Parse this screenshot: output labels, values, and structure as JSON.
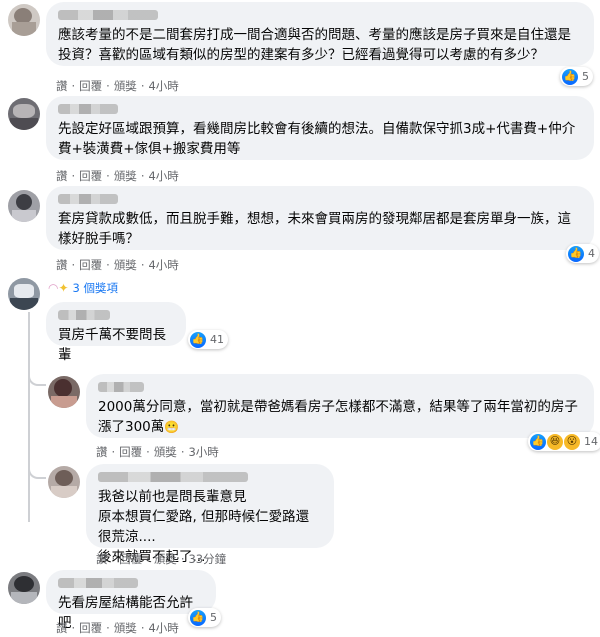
{
  "actions": {
    "like": "讚",
    "reply": "回覆",
    "share": "頒獎",
    "dot": "·"
  },
  "comments": [
    {
      "text": "應該考量的不是二間套房打成一間合適與否的問題、考量的應該是房子買來是自住還是投資？喜歡的區域有類似的房型的建案有多少？已經看過覺得可以考慮的有多少？",
      "time": "4小時",
      "reactions": "5"
    },
    {
      "text": "先設定好區域跟預算，看幾間房比較會有後續的想法。自備款保守抓3成+代書費+仲介費+裝潢費+傢俱+搬家費用等",
      "time": "4小時"
    },
    {
      "text": "套房貸款成數低，而且脫手難，想想，未來會買兩房的發現鄰居都是套房單身一族，這樣好脫手嗎？",
      "time": "4小時",
      "reactions": "4"
    },
    {
      "replies_label": "3 個獎項",
      "text": "買房千萬不要問長輩",
      "reactions": "41"
    },
    {
      "text": "2000萬分同意，當初就是帶爸媽看房子怎樣都不滿意，結果等了兩年當初的房子漲了300萬",
      "time": "3小時",
      "reactions": "14"
    },
    {
      "text": "我爸以前也是問長輩意見\n原本想買仁愛路, 但那時候仁愛路還很荒涼....\n後來就買不起了...",
      "time": "33分鐘"
    },
    {
      "text": "先看房屋結構能否允許吧",
      "time": "4小時",
      "reactions": "5"
    }
  ],
  "icons": {
    "like": "like-icon",
    "haha": "haha-icon",
    "wow": "wow-icon",
    "award": "award-icon",
    "grimace": "grimace-emoji"
  },
  "colors": {
    "bubble": "#f0f2f5",
    "meta": "#65676b",
    "like": "#0866ff",
    "award": "#1877f2"
  }
}
